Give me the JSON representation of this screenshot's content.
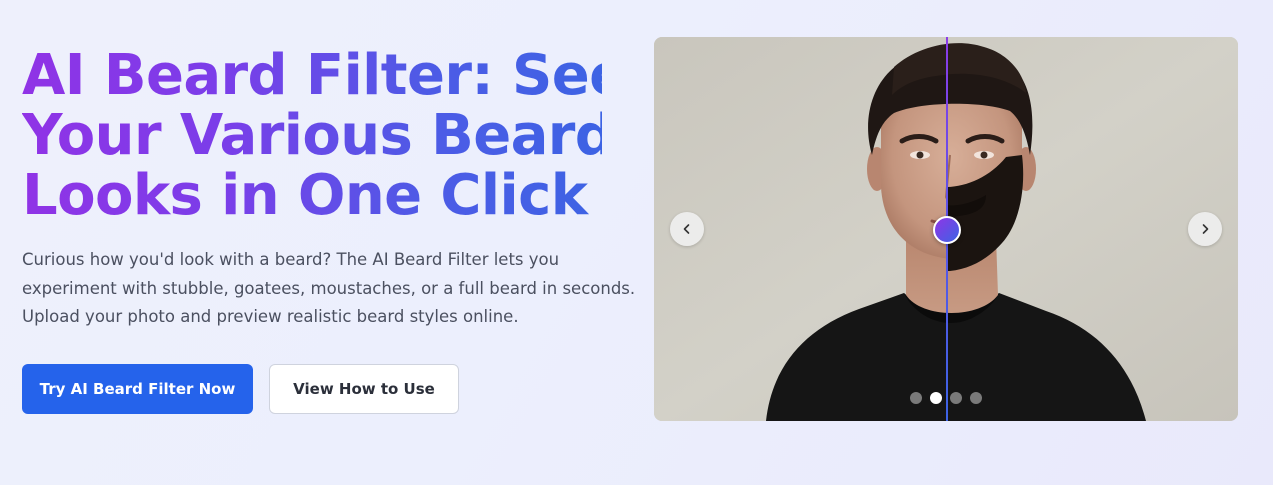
{
  "hero": {
    "title_lines": [
      "AI Beard Filter: See",
      "Your Various Beard",
      "Looks in One Click"
    ],
    "description_lines": [
      "Curious how you'd look with a beard? The AI Beard Filter lets you",
      "experiment with stubble, goatees, moustaches, or a full beard in seconds.",
      "Upload your photo and preview realistic beard styles online."
    ],
    "primary_button": "Try AI Beard Filter Now",
    "secondary_button": "View How to Use"
  },
  "slider": {
    "before_after_split": 0.5,
    "slides_total": 4,
    "active_slide": 2,
    "prev_icon": "chevron-left-icon",
    "next_icon": "chevron-right-icon"
  },
  "colors": {
    "title_gradient_start": "#9033e6",
    "title_gradient_end": "#3d63e4",
    "primary_button_bg": "#2563eb",
    "divider_start": "#8b3be8",
    "divider_end": "#3d63e4"
  }
}
